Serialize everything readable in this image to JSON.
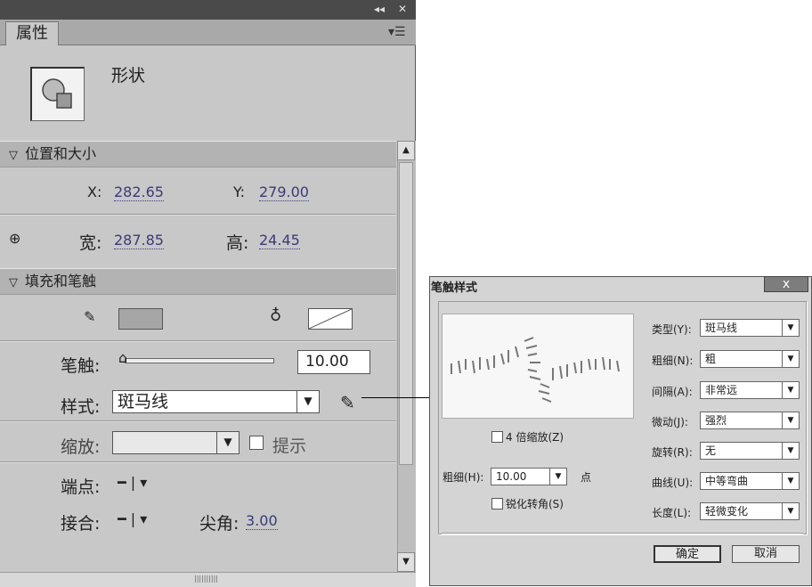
{
  "panel": {
    "tab_label": "属性",
    "shape_label": "形状",
    "position_section": "位置和大小",
    "x_label": "X:",
    "x_value": "282.65",
    "y_label": "Y:",
    "y_value": "279.00",
    "width_label": "宽:",
    "width_value": "287.85",
    "height_label": "高:",
    "height_value": "24.45",
    "fill_section": "填充和笔触",
    "stroke_label": "笔触:",
    "stroke_value": "10.00",
    "stroke_level": 0.0,
    "style_label": "样式:",
    "style_value": "斑马线",
    "scale_label": "缩放:",
    "scale_value": "",
    "hint_label": "提示",
    "cap_label": "端点:",
    "join_label": "接合:",
    "miter_label": "尖角:",
    "miter_value": "3.00",
    "stroke_color": "#a6a6a6",
    "fill_color": "none"
  },
  "dialog": {
    "title": "笔触样式",
    "close_label": "x",
    "zoom_label": "4 倍缩放(Z)",
    "thickness_label": "粗细(H):",
    "thickness_value": "10.00",
    "thickness_unit": "点",
    "sharpen_label": "锐化转角(S)",
    "fields": [
      {
        "label": "类型(Y):",
        "value": "斑马线"
      },
      {
        "label": "粗细(N):",
        "value": "粗"
      },
      {
        "label": "间隔(A):",
        "value": "非常远"
      },
      {
        "label": "微动(J):",
        "value": "强烈"
      },
      {
        "label": "旋转(R):",
        "value": "无"
      },
      {
        "label": "曲线(U):",
        "value": "中等弯曲"
      },
      {
        "label": "长度(L):",
        "value": "轻微变化"
      }
    ],
    "ok_label": "确定",
    "cancel_label": "取消"
  }
}
